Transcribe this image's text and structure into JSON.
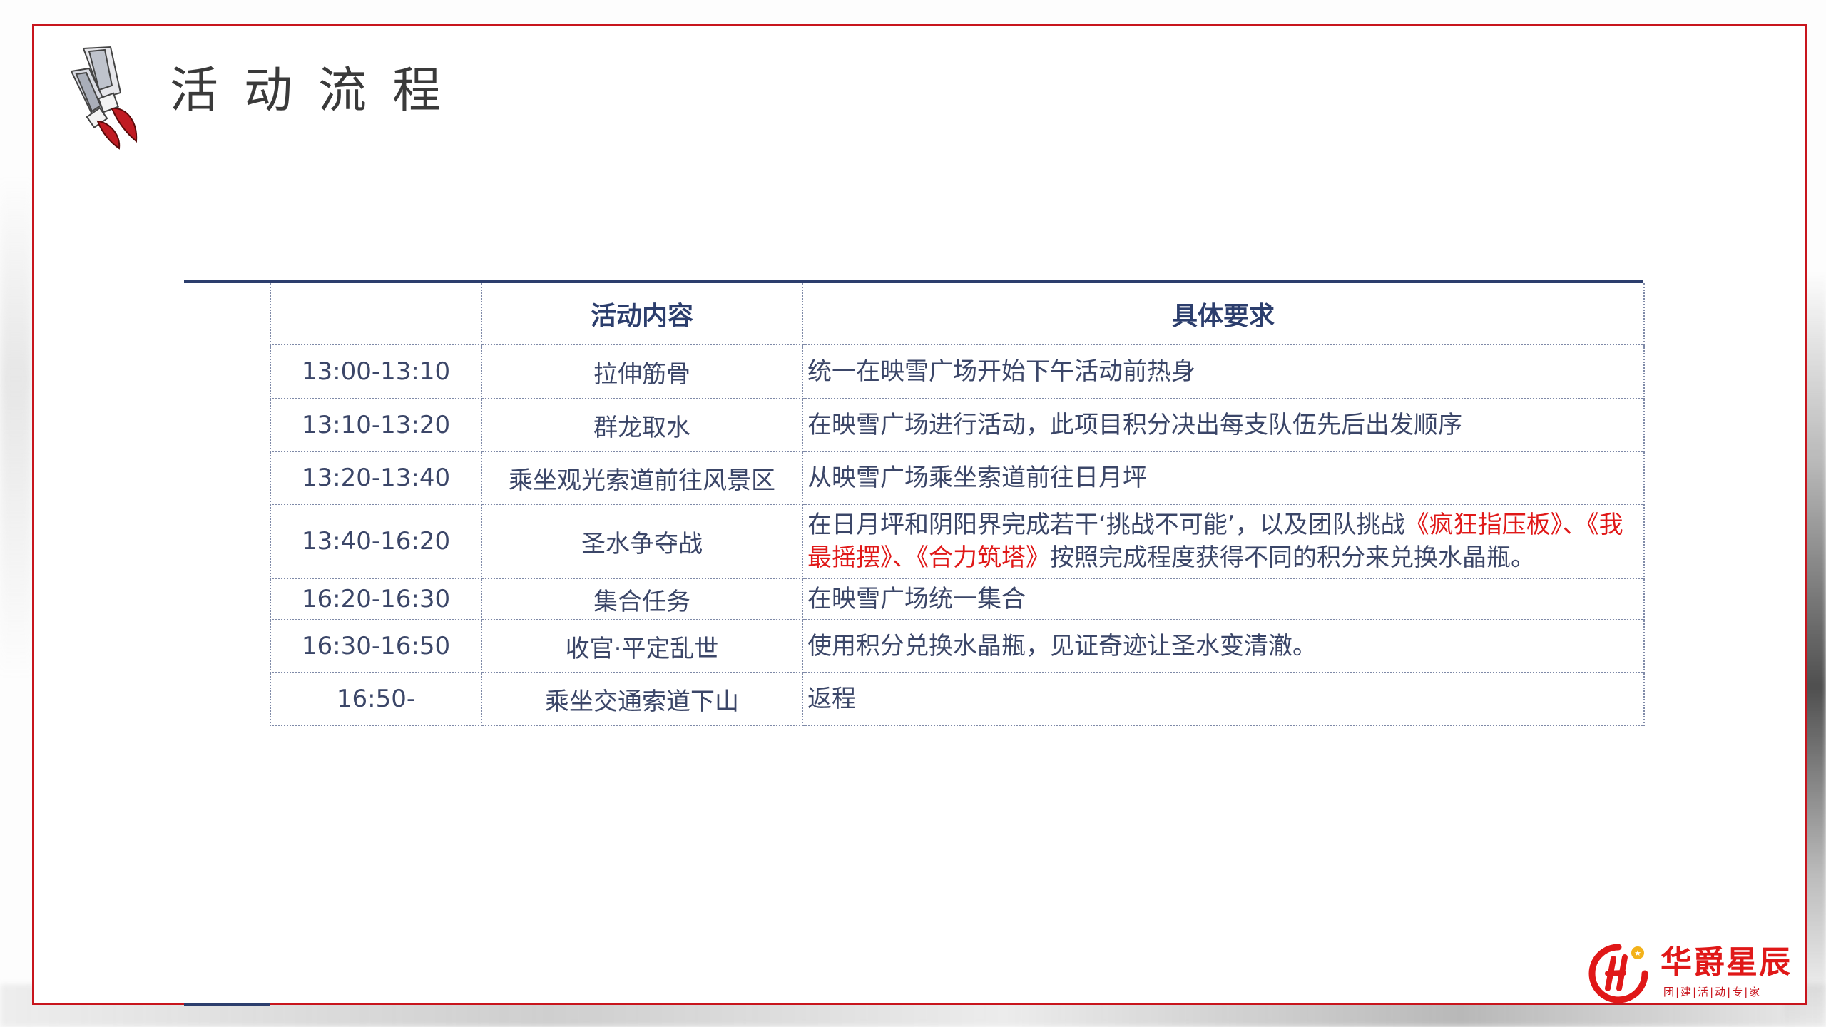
{
  "page": {
    "title": "活动流程"
  },
  "table": {
    "headers": [
      "",
      "活动内容",
      "具体要求"
    ],
    "rows": [
      {
        "time": "13:00-13:10",
        "activity": "拉伸筋骨",
        "requirement": [
          {
            "text": "统一在映雪广场开始下午活动前热身",
            "highlight": false
          }
        ]
      },
      {
        "time": "13:10-13:20",
        "activity": "群龙取水",
        "requirement": [
          {
            "text": "在映雪广场进行活动，此项目积分决出每支队伍先后出发顺序",
            "highlight": false
          }
        ]
      },
      {
        "time": "13:20-13:40",
        "activity": "乘坐观光索道前往风景区",
        "requirement": [
          {
            "text": "从映雪广场乘坐索道前往日月坪",
            "highlight": false
          }
        ]
      },
      {
        "time": "13:40-16:20",
        "activity": "圣水争夺战",
        "requirement": [
          {
            "text": "在日月坪和阴阳界完成若干‘挑战不可能’，以及团队挑战",
            "highlight": false
          },
          {
            "text": "《疯狂指压板》、《我最摇摆》、《合力筑塔》",
            "highlight": true
          },
          {
            "text": "按照完成程度获得不同的积分来兑换水晶瓶。",
            "highlight": false
          }
        ]
      },
      {
        "time": "16:20-16:30",
        "activity": "集合任务",
        "requirement": [
          {
            "text": "在映雪广场统一集合",
            "highlight": false
          }
        ]
      },
      {
        "time": "16:30-16:50",
        "activity": "收官·平定乱世",
        "requirement": [
          {
            "text": "使用积分兑换水晶瓶，见证奇迹让圣水变清澈。",
            "highlight": false
          }
        ]
      },
      {
        "time": "16:50-",
        "activity": "乘坐交通索道下山",
        "requirement": [
          {
            "text": " 返程",
            "highlight": false
          }
        ]
      }
    ]
  },
  "logo": {
    "name": "华爵星辰",
    "tagline": "团|建|活|动|专|家",
    "mark_letter": "H"
  },
  "colors": {
    "frame": "#c8151d",
    "header_rule": "#2c3e6d",
    "text": "#3b4668",
    "highlight": "#e01818"
  },
  "icons": {
    "title": "paintbrush-crossed-icon",
    "logo": "huajue-logo-icon"
  }
}
